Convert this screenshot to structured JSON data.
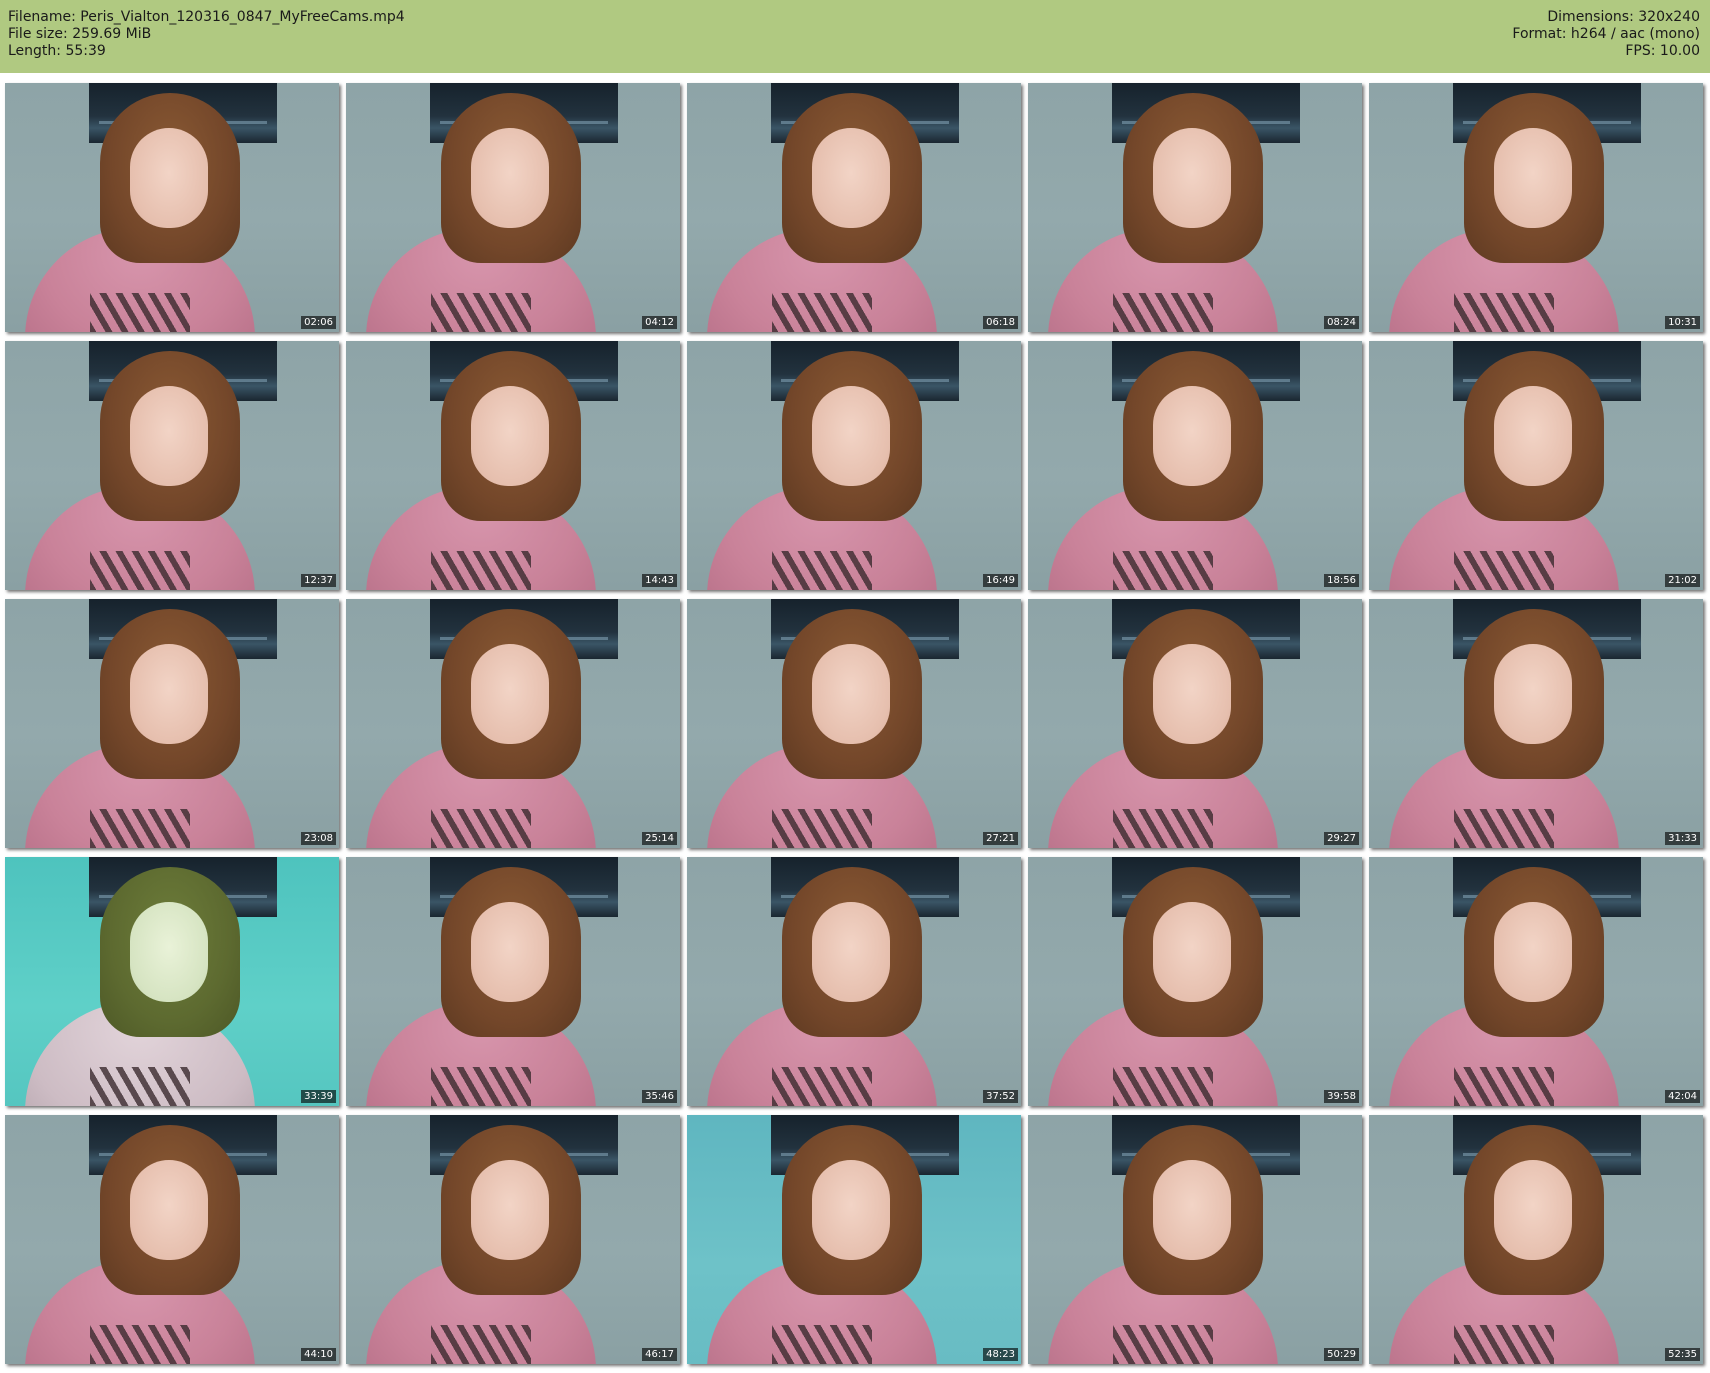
{
  "header": {
    "filename": "Filename: Peris_Vialton_120316_0847_MyFreeCams.mp4",
    "file_size": "File size: 259.69 MiB",
    "length": "Length: 55:39",
    "dimensions": "Dimensions: 320x240",
    "format": "Format: h264 / aac (mono)",
    "fps": "FPS: 10.00",
    "bg_color": "#b0c981"
  },
  "thumbnails": [
    {
      "time": "02:06",
      "watermark": ""
    },
    {
      "time": "04:12",
      "watermark": ""
    },
    {
      "time": "06:18",
      "watermark": ""
    },
    {
      "time": "08:24",
      "watermark": ""
    },
    {
      "time": "10:31",
      "watermark": ""
    },
    {
      "time": "12:37",
      "watermark": ""
    },
    {
      "time": "14:43",
      "watermark": ""
    },
    {
      "time": "16:49",
      "watermark": ""
    },
    {
      "time": "18:56",
      "watermark": ""
    },
    {
      "time": "21:02",
      "watermark": ""
    },
    {
      "time": "23:08",
      "watermark": ""
    },
    {
      "time": "25:14",
      "watermark": ""
    },
    {
      "time": "27:21",
      "watermark": ""
    },
    {
      "time": "29:27",
      "watermark": ""
    },
    {
      "time": "31:33",
      "watermark": ""
    },
    {
      "time": "33:39",
      "watermark": ""
    },
    {
      "time": "35:46",
      "watermark": ""
    },
    {
      "time": "37:52",
      "watermark": ""
    },
    {
      "time": "39:58",
      "watermark": ""
    },
    {
      "time": "42:04",
      "watermark": ""
    },
    {
      "time": "44:10",
      "watermark": ""
    },
    {
      "time": "46:17",
      "watermark": ""
    },
    {
      "time": "48:23",
      "watermark": ""
    },
    {
      "time": "50:29",
      "watermark": ""
    },
    {
      "time": "52:35",
      "watermark": ""
    }
  ]
}
